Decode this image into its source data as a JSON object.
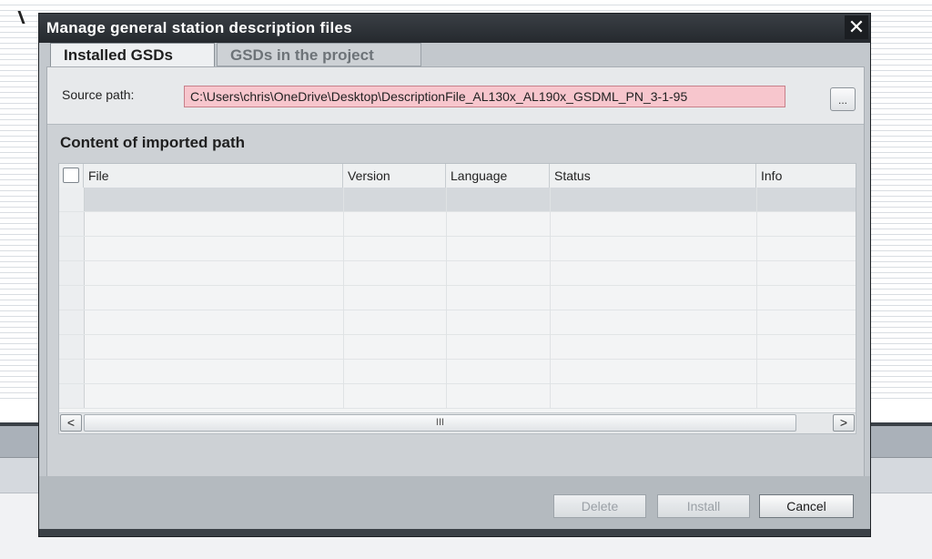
{
  "dialog": {
    "title": "Manage general station description files",
    "close_icon": "close-icon"
  },
  "tabs": [
    {
      "label": "Installed GSDs",
      "active": true
    },
    {
      "label": "GSDs in the project",
      "active": false
    }
  ],
  "source": {
    "label": "Source path:",
    "value": "C:\\Users\\chris\\OneDrive\\Desktop\\DescriptionFile_AL130x_AL190x_GSDML_PN_3-1-95",
    "browse_label": "...",
    "invalid_color": "#f7c6cd"
  },
  "content": {
    "title": "Content of imported path",
    "columns": [
      "File",
      "Version",
      "Language",
      "Status",
      "Info"
    ],
    "rows": []
  },
  "scrollbar": {
    "left_icon": "chevron-left-icon",
    "left_glyph": "<",
    "right_icon": "chevron-right-icon",
    "right_glyph": ">",
    "grip": "III"
  },
  "buttons": {
    "delete": "Delete",
    "install": "Install",
    "cancel": "Cancel"
  }
}
